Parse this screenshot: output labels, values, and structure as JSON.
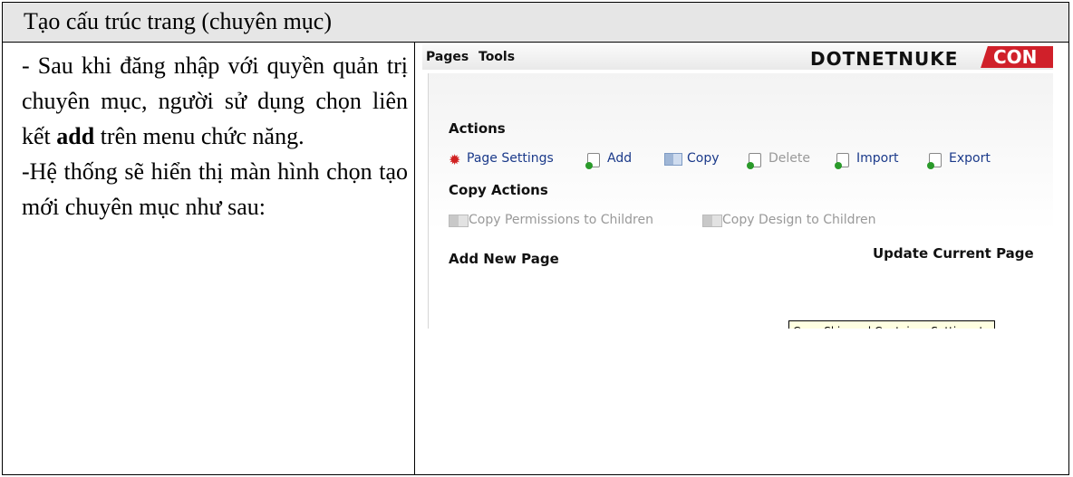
{
  "header": {
    "title": "Tạo cấu trúc trang (chuyên mục)"
  },
  "left": {
    "para1_pre": "- Sau khi đăng nhập với quyền quản trị chuyên mục, người sử dụng chọn liên kết ",
    "para1_bold": "add",
    "para1_post": " trên menu chức năng.",
    "para2": "-Hệ thống sẽ hiển thị màn hình chọn tạo mới chuyên mục như sau:"
  },
  "screenshot": {
    "menu": [
      "Pages",
      "Tools"
    ],
    "logo_text": "DOTNETNUKE",
    "logo_badge": "CON",
    "actions_title": "Actions",
    "actions": [
      {
        "label": "Page Settings",
        "icon": "gear-icon",
        "enabled": true
      },
      {
        "label": "Add",
        "icon": "page-add-icon",
        "enabled": true
      },
      {
        "label": "Copy",
        "icon": "copy-icon",
        "enabled": true
      },
      {
        "label": "Delete",
        "icon": "page-delete-icon",
        "enabled": false
      },
      {
        "label": "Import",
        "icon": "page-import-icon",
        "enabled": true
      },
      {
        "label": "Export",
        "icon": "page-export-icon",
        "enabled": true
      }
    ],
    "copy_actions_title": "Copy Actions",
    "copy_actions": [
      {
        "label": "Copy Permissions to Children",
        "enabled": false
      },
      {
        "label": "Copy Design to Children",
        "enabled": false
      }
    ],
    "add_new_page_title": "Add New Page",
    "update_current_page_title": "Update Current Page",
    "tooltip": "Copy Skin and Container Settings to"
  }
}
